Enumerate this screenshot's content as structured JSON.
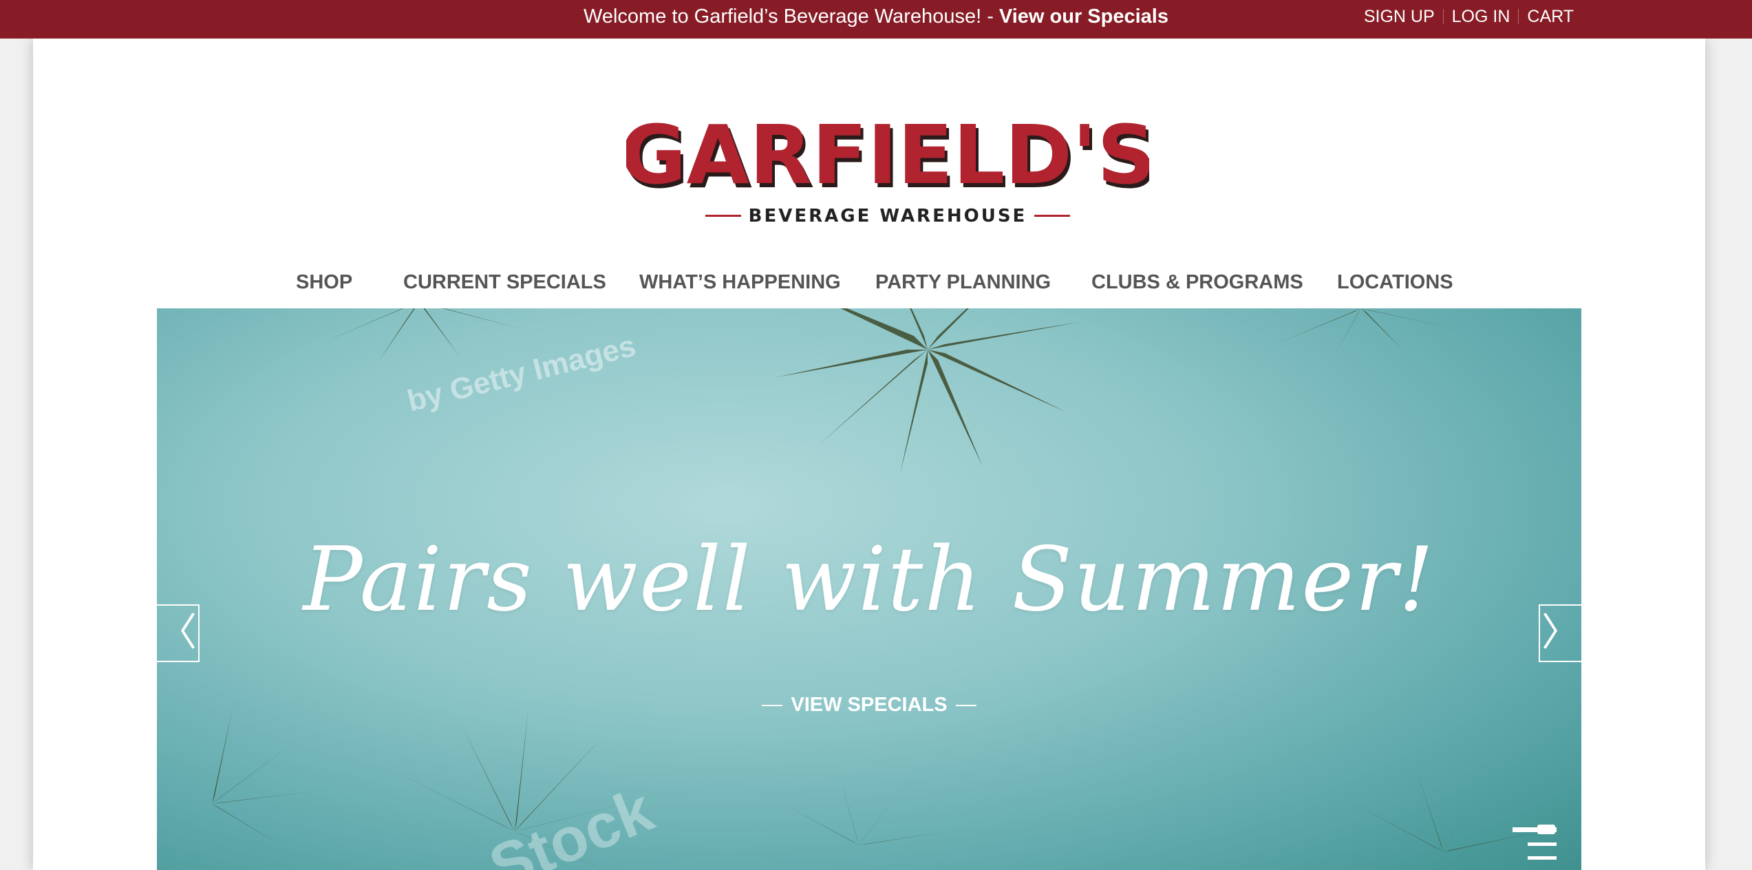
{
  "topbar": {
    "welcome_text": "Welcome to Garfield’s Beverage Warehouse! - ",
    "specials_link": "View our Specials",
    "sign_up": "SIGN UP",
    "log_in": "LOG IN",
    "cart": "CART",
    "color": "#871c26"
  },
  "logo": {
    "name": "GARFIELD'S",
    "tagline": "BEVERAGE WAREHOUSE"
  },
  "nav": {
    "items": [
      {
        "label": "SHOP"
      },
      {
        "label": "CURRENT SPECIALS"
      },
      {
        "label": "WHAT’S HAPPENING"
      },
      {
        "label": "PARTY PLANNING"
      },
      {
        "label": "CLUBS & PROGRAMS"
      },
      {
        "label": "LOCATIONS"
      }
    ]
  },
  "hero": {
    "headline": "Pairs well with Summer!",
    "cta": "VIEW SPECIALS",
    "watermark_top": "by Getty Images",
    "watermark_bottom": "Stock",
    "prev_icon": "chevron-left-icon",
    "next_icon": "chevron-right-icon",
    "menu_icon": "hamburger-icon"
  }
}
